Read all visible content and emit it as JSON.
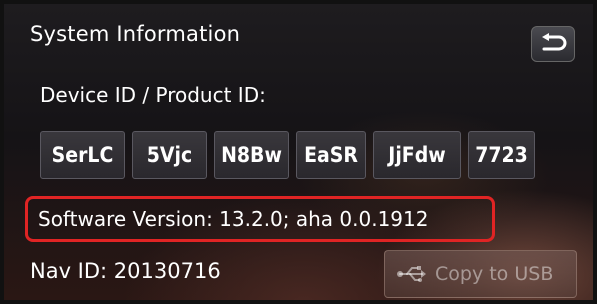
{
  "screen": {
    "title": "System Information",
    "back_icon": "return-arrow-icon"
  },
  "device": {
    "label": "Device ID / Product ID:",
    "ids": [
      "SerLC",
      "5Vjc",
      "N8Bw",
      "EaSR",
      "JjFdw",
      "7723"
    ]
  },
  "software": {
    "text": "Software Version: 13.2.0; aha 0.0.1912",
    "highlight_color": "#e02424"
  },
  "nav": {
    "text": "Nav ID: 20130716"
  },
  "copy_button": {
    "label": "Copy to USB",
    "icon": "usb-icon"
  }
}
